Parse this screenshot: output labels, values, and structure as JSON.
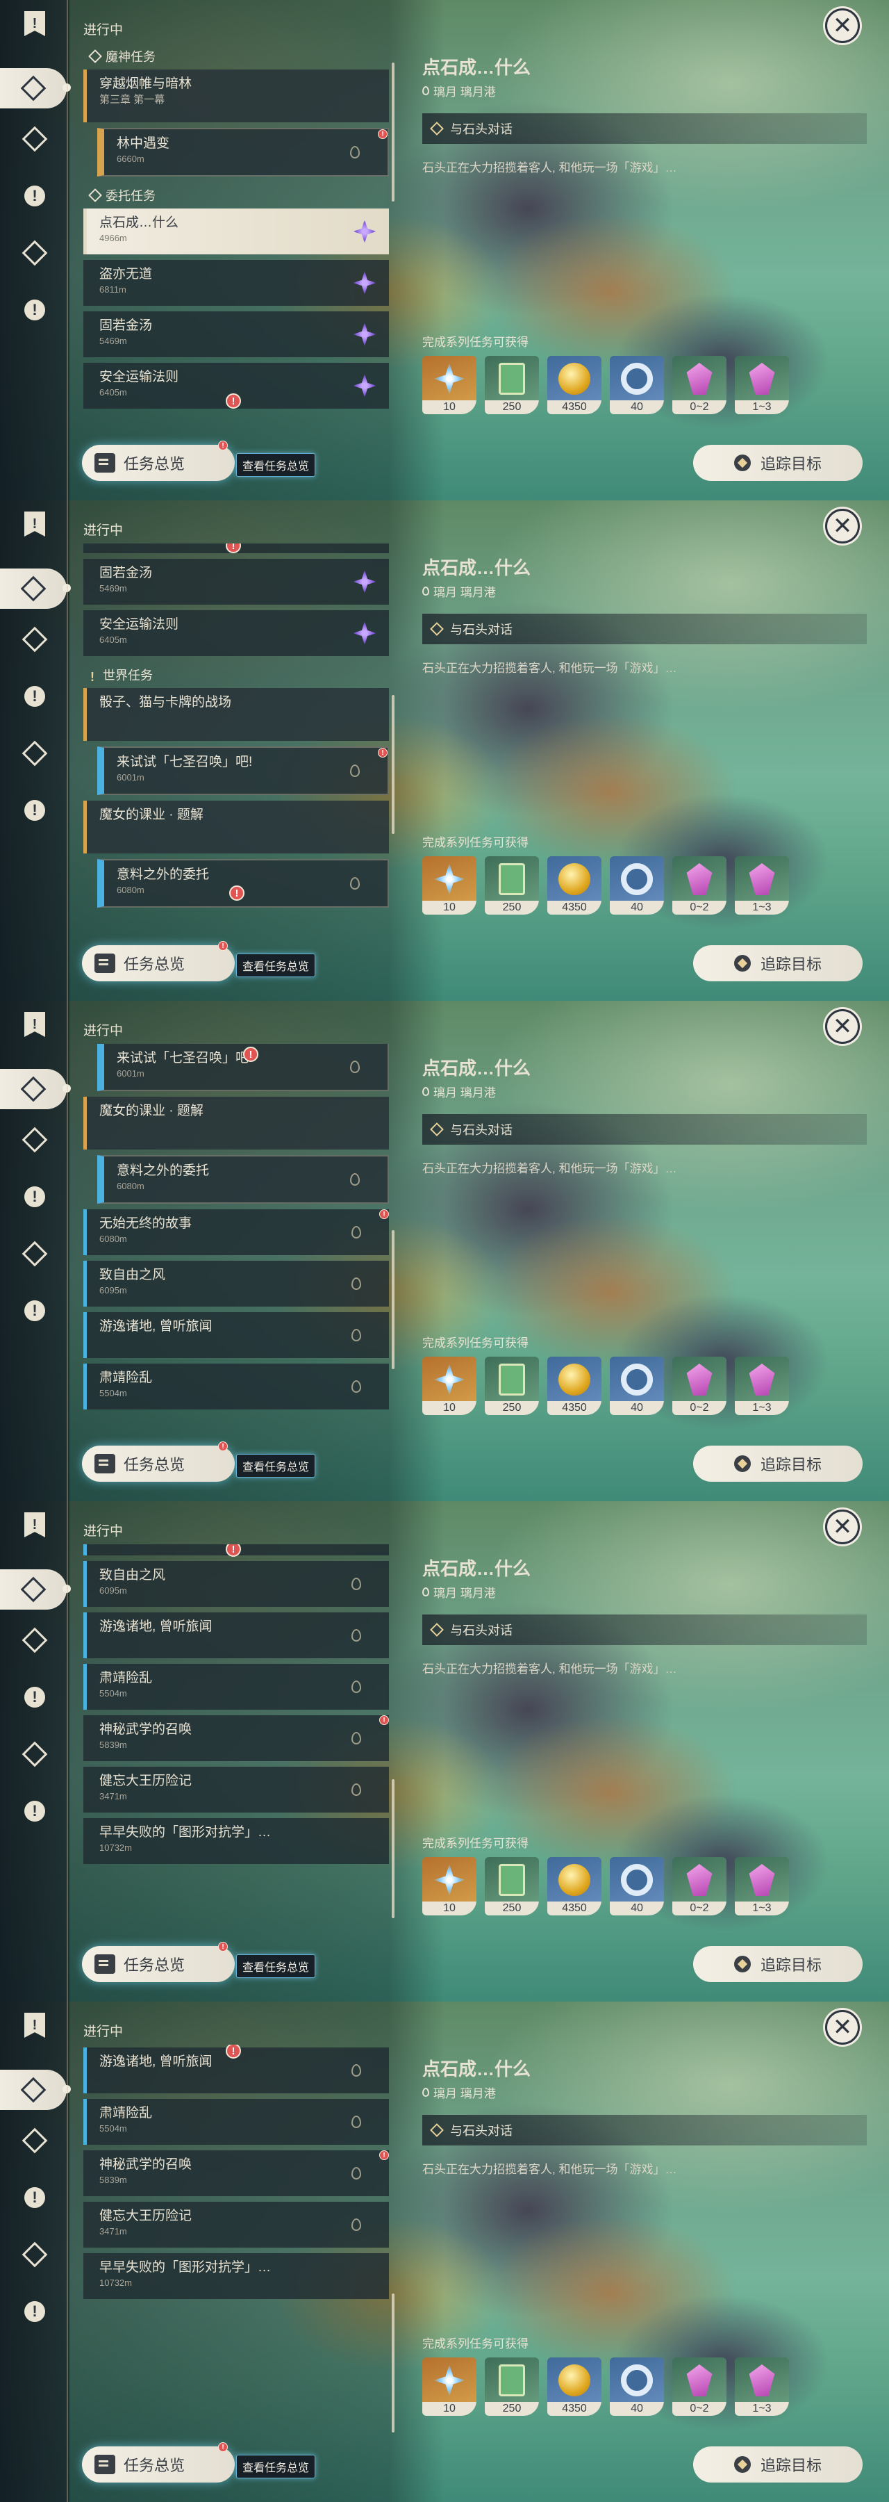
{
  "header": "进行中",
  "close": "✕",
  "sections": {
    "archon": "魔神任务",
    "commission": "委托任务",
    "world": "世界任务"
  },
  "quests": {
    "archon_group": {
      "title": "穿越烟帷与暗林",
      "sub": "第三章 第一幕"
    },
    "forest": {
      "title": "林中遇变",
      "dist": "6660m"
    },
    "stone": {
      "title": "点石成…什么",
      "dist": "4966m"
    },
    "thief": {
      "title": "盗亦无道",
      "dist": "6811m"
    },
    "golden": {
      "title": "固若金汤",
      "dist": "5469m"
    },
    "safety": {
      "title": "安全运输法则",
      "dist": "6405m"
    },
    "dice_group": {
      "title": "骰子、猫与卡牌的战场"
    },
    "tcg": {
      "title": "来试试「七圣召唤」吧!",
      "dist": "6001m"
    },
    "witch_group": {
      "title": "魔女的课业 · 题解"
    },
    "unexpected": {
      "title": "意料之外的委托",
      "dist": "6080m"
    },
    "endless": {
      "title": "无始无终的故事",
      "dist": "6080m"
    },
    "wind": {
      "title": "致自由之风",
      "dist": "6095m"
    },
    "wander": {
      "title": "游逸诸地, 曾听旅闻",
      "dist": ""
    },
    "pacify": {
      "title": "肃靖险乱",
      "dist": "5504m"
    },
    "martial": {
      "title": "神秘武学的召唤",
      "dist": "5839m"
    },
    "forgotten": {
      "title": "健忘大王历险记",
      "dist": "3471m"
    },
    "premature": {
      "title": "早早失败的「图形对抗学」…",
      "dist": "10732m"
    }
  },
  "detail": {
    "title": "点石成…什么",
    "location_1": "璃月 璃月港",
    "location_2": "璃月  璃月港",
    "objective": "与石头对话",
    "description": "石头正在大力招揽着客人, 和他玩一场「游戏」…",
    "rewards_label": "完成系列任务可获得",
    "rewards": [
      {
        "icon": "primogem-icon",
        "count": "10"
      },
      {
        "icon": "adventure-exp-icon",
        "count": "250"
      },
      {
        "icon": "mora-icon",
        "count": "4350"
      },
      {
        "icon": "companionship-exp-icon",
        "count": "40"
      },
      {
        "icon": "crystal-chunk-icon",
        "count": "0~2"
      },
      {
        "icon": "crystal-cluster-icon",
        "count": "1~3"
      }
    ]
  },
  "buttons": {
    "overview": "任务总览",
    "overview_hint": "查看任务总览",
    "track": "追踪目标"
  },
  "badge": "!"
}
